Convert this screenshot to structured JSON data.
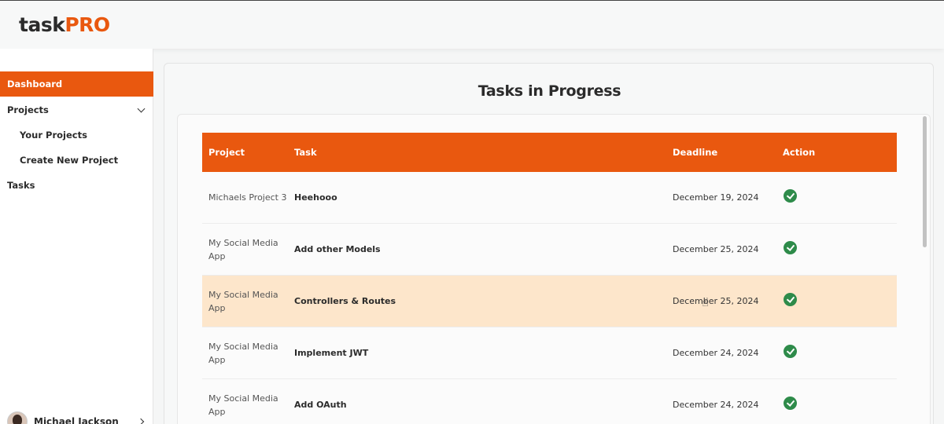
{
  "app": {
    "logo_task": "task",
    "logo_pro": "PRO",
    "accent_color": "#e9580f"
  },
  "sidebar": {
    "items": [
      {
        "label": "Dashboard",
        "active": true
      },
      {
        "label": "Projects",
        "expandable": true
      },
      {
        "label": "Your Projects",
        "sub": true
      },
      {
        "label": "Create New Project",
        "sub": true
      },
      {
        "label": "Tasks"
      }
    ],
    "user": {
      "name": "Michael Jackson"
    }
  },
  "main": {
    "title": "Tasks in Progress",
    "table": {
      "headers": [
        "Project",
        "Task",
        "Deadline",
        "Action"
      ],
      "rows": [
        {
          "project": "Michaels Project 3",
          "task": "Heehooo",
          "deadline": "December 19, 2024",
          "action": "check-circle-icon"
        },
        {
          "project": "My Social Media App",
          "task": "Add other Models",
          "deadline": "December 25, 2024",
          "action": "check-circle-icon"
        },
        {
          "project": "My Social Media App",
          "task": "Controllers & Routes",
          "deadline": "December 25, 2024",
          "action": "check-circle-icon",
          "highlighted": true
        },
        {
          "project": "My Social Media App",
          "task": "Implement JWT",
          "deadline": "December 24, 2024",
          "action": "check-circle-icon"
        },
        {
          "project": "My Social Media App",
          "task": "Add OAuth",
          "deadline": "December 24, 2024",
          "action": "check-circle-icon"
        }
      ]
    }
  },
  "colors": {
    "highlight_row": "#fde6cb",
    "check_green": "#2e8b4a"
  }
}
